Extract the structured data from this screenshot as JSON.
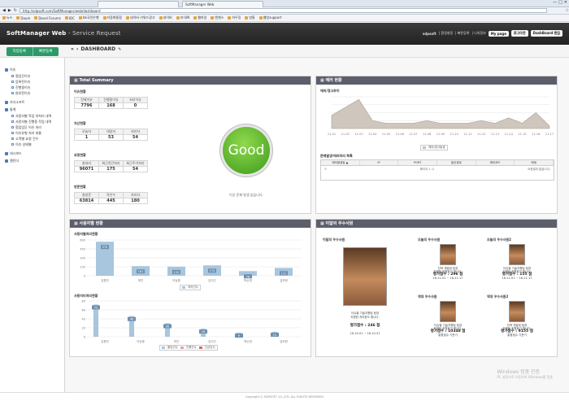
{
  "browser": {
    "tabs": [
      "",
      "SoftManager Web"
    ],
    "url": "http://sdpsoft.com/SoftManager/web/dashboard",
    "bookmarks": [
      "뉴스",
      "Daum",
      "Devel Forums",
      "IDC",
      "bk국민은행",
      "자동화통합",
      "네이버 키워드광고",
      "네이버",
      "지식IN",
      "웹마일",
      "엔젠스",
      "하우징",
      "방통",
      "웹방support"
    ]
  },
  "header": {
    "title": "SoftManager Web",
    "subtitle": " - Service Request",
    "user": "sdpsoft",
    "links": [
      "| 환경설정",
      "| 빠른등록",
      "| 나의정보"
    ],
    "buttons": [
      "My page",
      "로그아웃",
      "DashBoard 편집"
    ]
  },
  "actions": {
    "register": "작업등록",
    "quick": "빠른등록"
  },
  "breadcrumb": "DASHBOARD",
  "sidebar": {
    "issue": "이슈",
    "issue_items": [
      "협업진이슈",
      "등록된이슈",
      "진행중이슈",
      "완료된이슈"
    ],
    "knowledge": "지식소프트",
    "stats": "통계",
    "stats_items": [
      "사용자별 작업 미처리 내역",
      "사용자별 진행중 작업 내역",
      "협업업무 이슈 처리",
      "이슈유형 처리 비율",
      "고객별 요청 건수",
      "이슈 상태별"
    ],
    "dashboard": "대시보드",
    "calendar": "캘린더"
  },
  "total_summary": {
    "title": "Total Summary",
    "sections": [
      {
        "name": "이슈현황",
        "headers": [
          "전체이슈",
          "진행중이슈",
          "처리이슈"
        ],
        "values": [
          "7796",
          "168",
          "0"
        ]
      },
      {
        "name": "자산현황",
        "headers": [
          "오늘자",
          "대일자",
          "처리자"
        ],
        "values": [
          "1",
          "53",
          "54"
        ]
      },
      {
        "name": "요청현황",
        "headers": [
          "총처리",
          "최근연간처리",
          "최근주기처리"
        ],
        "values": [
          "96071",
          "175",
          "54"
        ]
      },
      {
        "name": "방문현황",
        "headers": [
          "총방문",
          "작년수",
          "처리자"
        ],
        "values": [
          "63814",
          "445",
          "180"
        ]
      }
    ],
    "status": "Good",
    "status_caption": "이상 문제 발생 없습니다."
  },
  "error_panel": {
    "title": "에러 현황",
    "chart_label": "에러/경고추이",
    "legend": "에러/경고발생",
    "table_label": "문제발생/에러처리 목록",
    "headers": [
      "에러발생일 ▲",
      "IP",
      "PORT",
      "발신경로",
      "에러코드",
      "메세"
    ],
    "pager": "페이지  1  /1",
    "empty_text": "요청결과 없습니다."
  },
  "user_panel": {
    "title": "사용자별 현황",
    "chart1_label": "사용자별처리현황",
    "chart1_legend": "처리건수",
    "chart2_label": "사용자미처리현황",
    "chart2_legend": [
      "할당건수",
      "진행건수",
      "긴급건수"
    ]
  },
  "best_panel": {
    "title": "이달의 우수사원",
    "month_label": "이달의 우수사원",
    "month_caption": "이슈별 기술지원팀 팀장\n지원한 처리한도 합니다.",
    "month_score": "평가점수 : 246 점",
    "month_date": "16-10-01 ~ 16-10-31",
    "cards": [
      {
        "label": "오늘의 우수사원",
        "caption": "전략 개발팀 팀장\n지원한 조원회기 합니다.",
        "score": "평가점수 : 296 점",
        "date": "16-11-01 ~ 16-11-17"
      },
      {
        "label": "오늘의 우수사원2",
        "caption": "이슈별 기술지원팀 팀장\n지원한 조원회기 합니다.",
        "score": "평가점수 : 155 점",
        "date": "16-11-01 ~ 16-11-17"
      },
      {
        "label": "역대 우수사원",
        "caption": "이슈별 기술지원팀 팀장\n지원한 조원회기 합니다.",
        "score": "평가점수 : 10348 점",
        "date": "통합점수 기준기"
      },
      {
        "label": "역대 우수사원2",
        "caption": "전략 개발팀 팀장\n지원한 조원회기 합니다.",
        "score": "평가점수 : 9155 점",
        "date": "통합점수 기준기"
      }
    ]
  },
  "footer": "Copyright ⓒ SDPSOFT CO.,LTD. ALL RIGHTS RESERVED",
  "watermark": {
    "line1": "Windows 정품 인증",
    "line2": "PC 설정으로 이동하여 Windows를 정품"
  },
  "chart_data": [
    {
      "type": "area",
      "title": "에러/경고추이",
      "x": [
        "11-01",
        "11-02",
        "11-03",
        "11-04",
        "11-05",
        "11-06",
        "11-07",
        "11-08",
        "11-09",
        "11-10",
        "11-11",
        "11-12",
        "11-13",
        "11-14",
        "11-15",
        "11-16",
        "11-17"
      ],
      "series": [
        {
          "name": "에러/경고발생",
          "values": [
            5,
            8,
            11,
            3,
            2,
            2,
            2,
            3,
            2,
            2,
            2,
            3,
            2,
            4,
            2,
            6,
            1
          ]
        }
      ],
      "ylim": [
        0,
        12
      ]
    },
    {
      "type": "bar",
      "title": "사용자별처리현황",
      "categories": [
        "김원전",
        "최진",
        "이남종",
        "김이근",
        "박순영",
        "김보현"
      ],
      "series": [
        {
          "name": "처리건수",
          "values": [
            570,
            161,
            152,
            174,
            78,
            131
          ]
        }
      ],
      "ylim": [
        0,
        600
      ]
    },
    {
      "type": "bar",
      "title": "사용자미처리현황",
      "categories": [
        "김원전",
        "이남종",
        "최진",
        "김이근",
        "박순영",
        "김보현"
      ],
      "series": [
        {
          "name": "할당건수",
          "values": [
            72,
            46,
            30,
            18,
            9,
            11
          ]
        },
        {
          "name": "진행건수",
          "values": [
            0,
            0,
            0,
            0,
            0,
            0
          ]
        },
        {
          "name": "긴급건수",
          "values": [
            0,
            0,
            0,
            0,
            0,
            0
          ]
        }
      ],
      "ylim": [
        0,
        80
      ]
    }
  ]
}
